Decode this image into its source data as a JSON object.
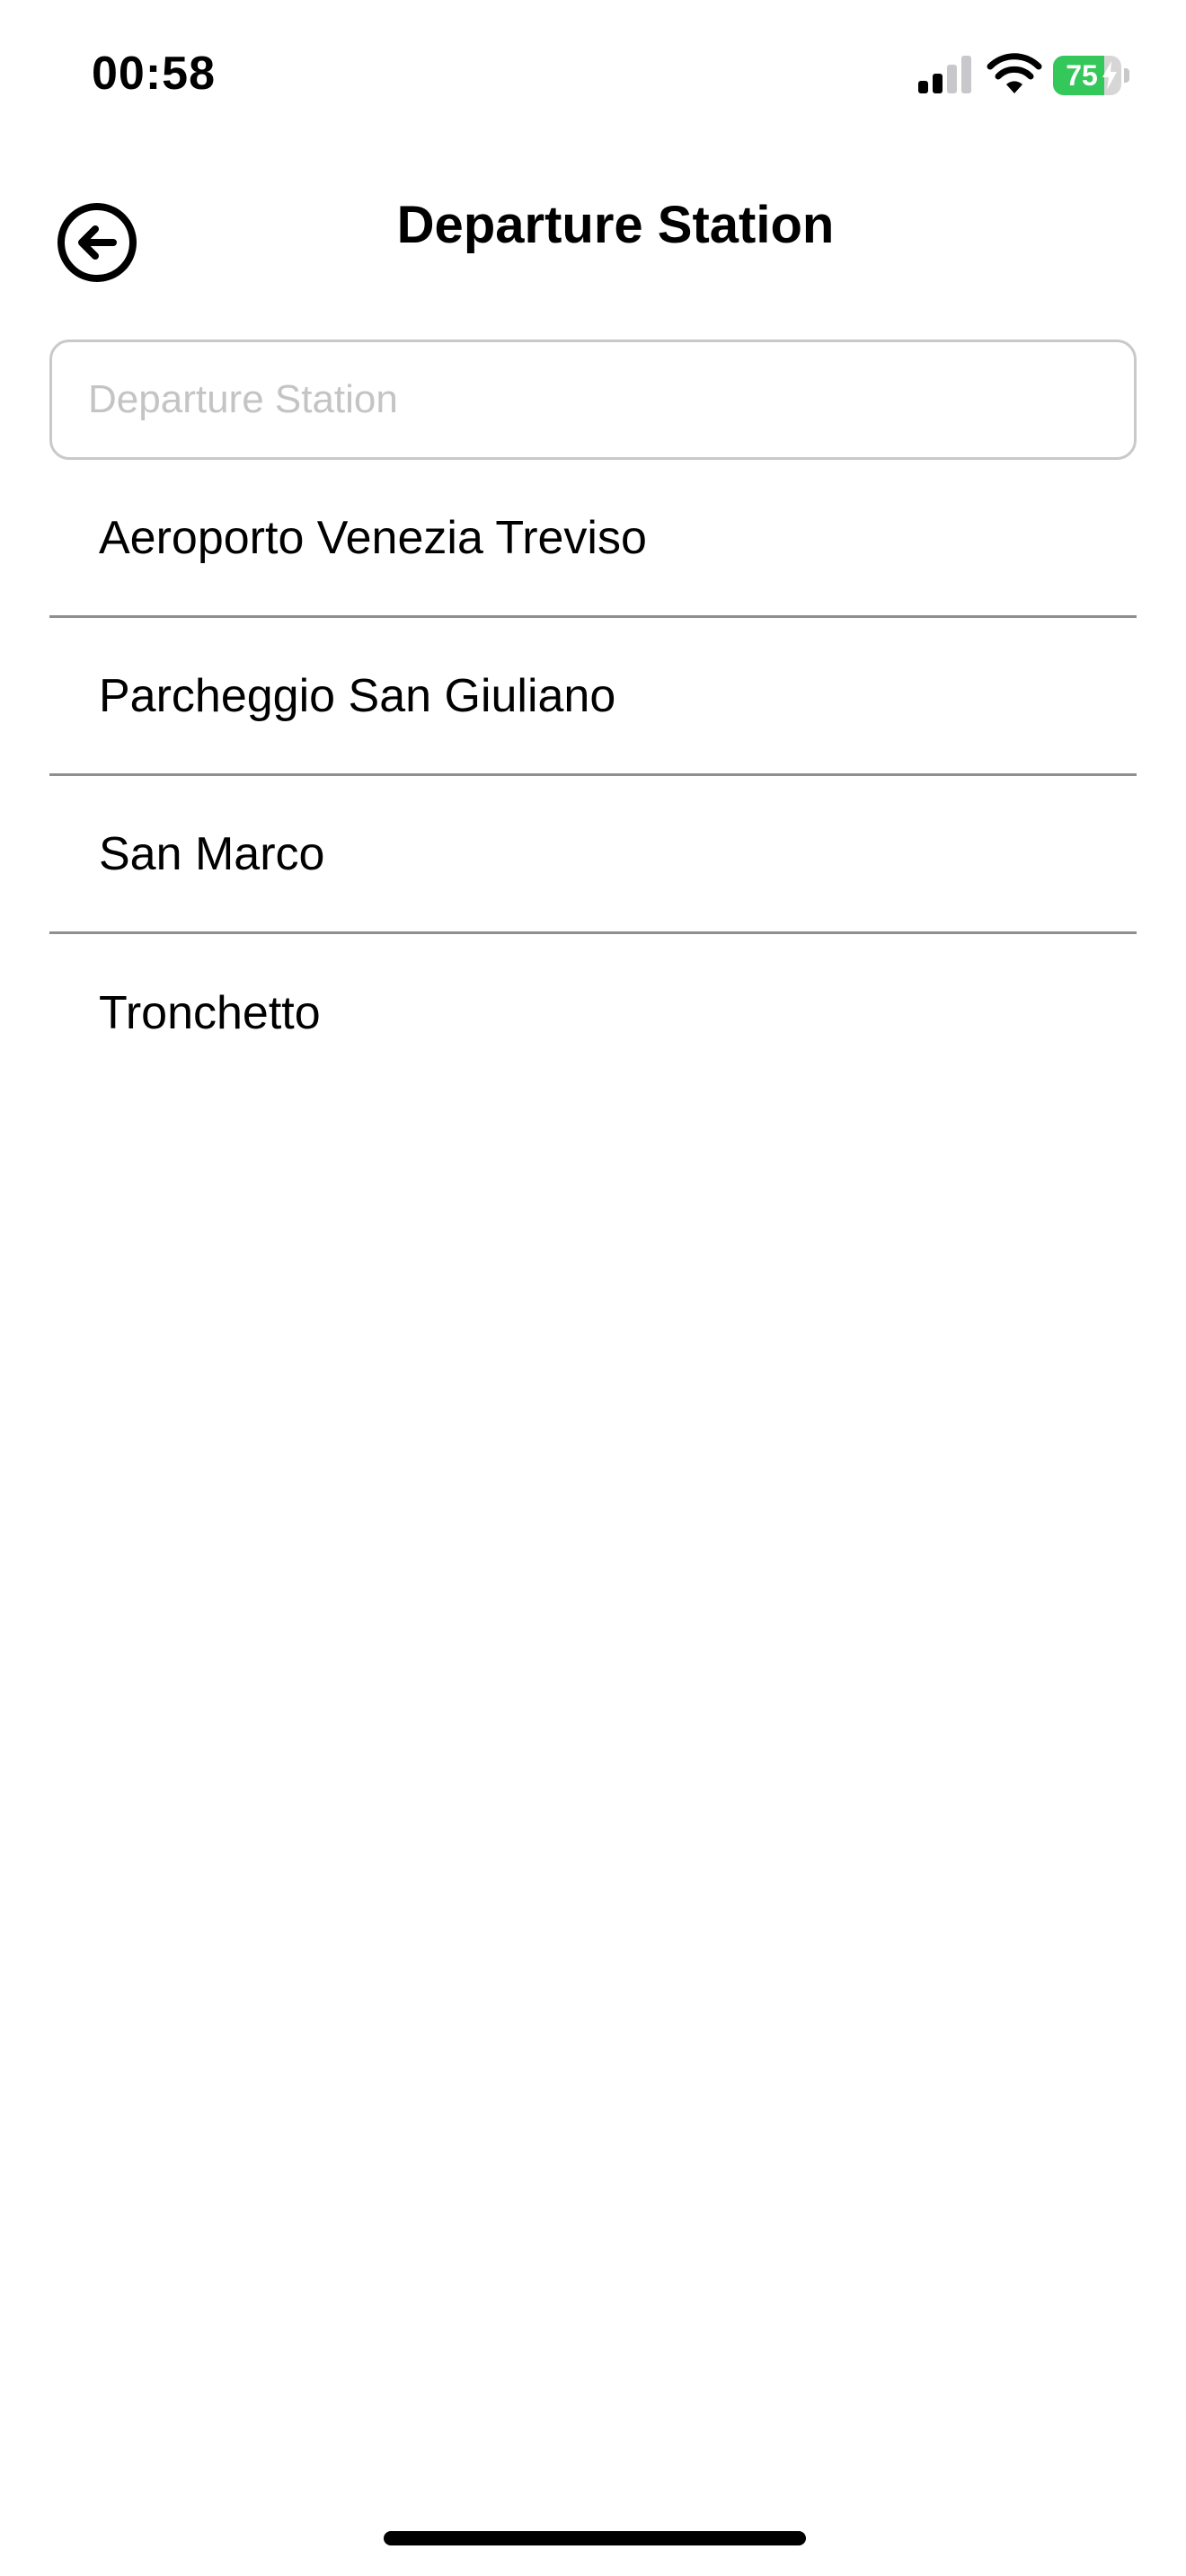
{
  "status_bar": {
    "time": "00:58",
    "battery_percent": "75",
    "battery_level": 0.75,
    "battery_color": "#34c759",
    "icons": [
      "signal-icon",
      "wifi-icon",
      "battery-icon",
      "charging-bolt-icon"
    ]
  },
  "header": {
    "title": "Departure Station",
    "back_icon": "arrow-left-circle-icon"
  },
  "search": {
    "value": "",
    "placeholder": "Departure Station"
  },
  "stations": [
    {
      "label": "Aeroporto Venezia Treviso"
    },
    {
      "label": "Parcheggio San Giuliano"
    },
    {
      "label": "San Marco"
    },
    {
      "label": "Tronchetto"
    }
  ]
}
